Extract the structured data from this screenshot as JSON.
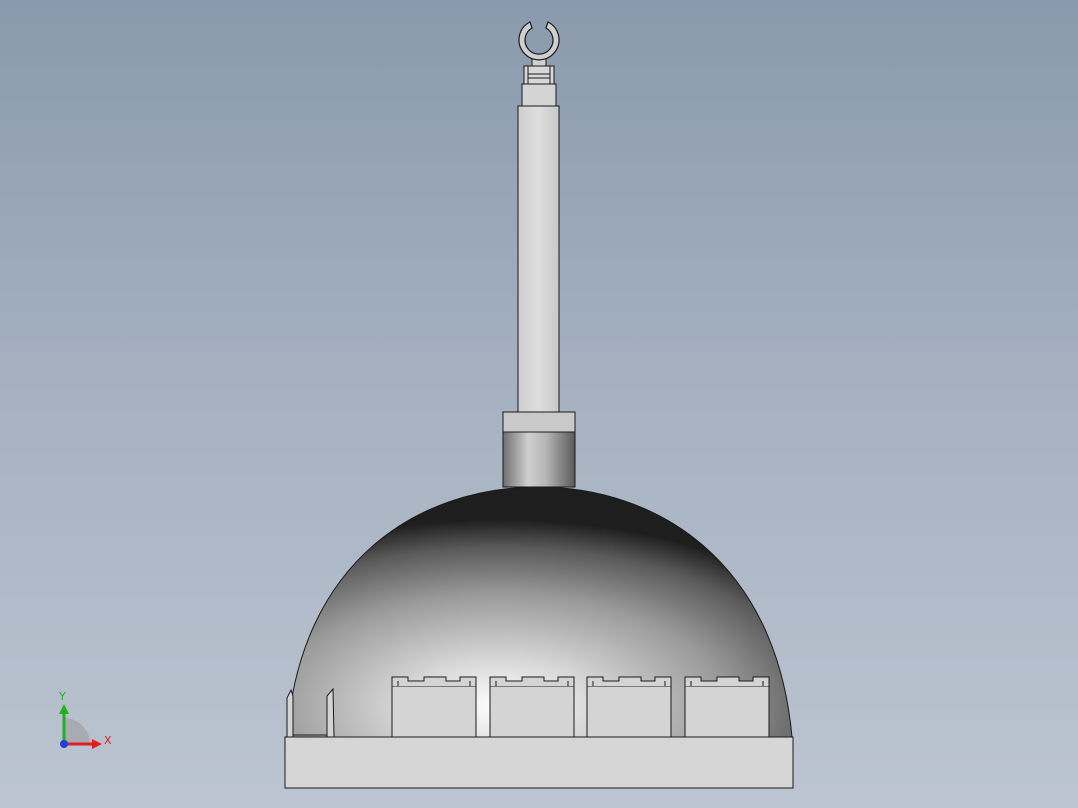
{
  "triad": {
    "x_label": "X",
    "y_label": "Y",
    "colors": {
      "x_axis": "#e02020",
      "y_axis": "#20b020",
      "z_axis": "#2040e0"
    }
  },
  "colors": {
    "background_top": "#8a99ad",
    "background_bottom": "#bcc5d1",
    "part_fill": "#d6d6d6",
    "edge": "#1a1a1a"
  }
}
